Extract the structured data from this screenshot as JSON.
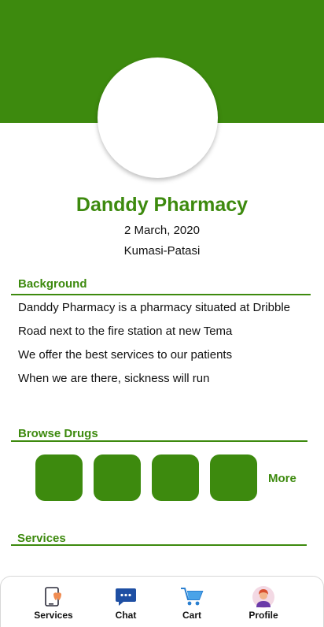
{
  "colors": {
    "brand_green": "#3d8a0e"
  },
  "profile": {
    "name": "Danddy Pharmacy",
    "date": "2 March, 2020",
    "location": "Kumasi-Patasi"
  },
  "background": {
    "title": "Background",
    "lines": [
      "Danddy Pharmacy is a pharmacy situated at Dribble",
      "Road next to the fire station at new Tema",
      "We offer the best services to our patients",
      "When we are there, sickness will run"
    ]
  },
  "browse_drugs": {
    "title": "Browse Drugs",
    "more_label": "More"
  },
  "services": {
    "title": "Services"
  },
  "bottom_nav": {
    "items": [
      {
        "label": "Services",
        "icon": "phone-tooth-icon"
      },
      {
        "label": "Chat",
        "icon": "chat-bubble-icon"
      },
      {
        "label": "Cart",
        "icon": "shopping-cart-icon"
      },
      {
        "label": "Profile",
        "icon": "user-avatar-icon"
      }
    ]
  }
}
